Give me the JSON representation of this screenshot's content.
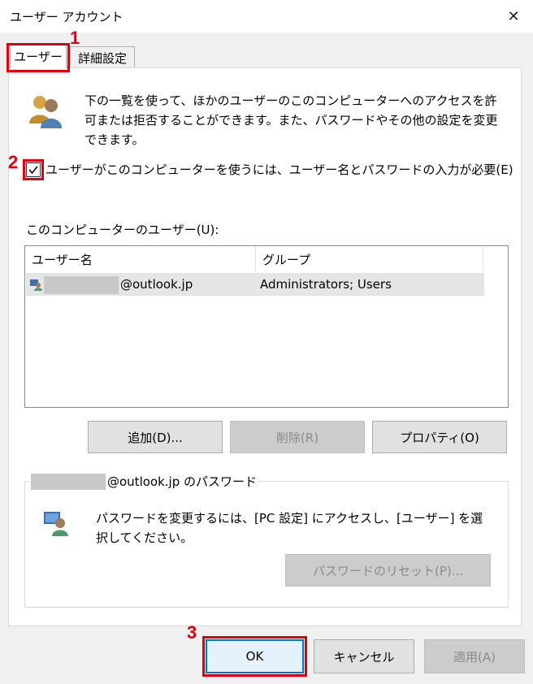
{
  "window": {
    "title": "ユーザー アカウント",
    "close_glyph": "✕"
  },
  "tabs": [
    {
      "label": "ユーザー",
      "active": true
    },
    {
      "label": "詳細設定",
      "active": false
    }
  ],
  "markers": [
    "1",
    "2",
    "3"
  ],
  "description": "下の一覧を使って、ほかのユーザーのこのコンピューターへのアクセスを許可または拒否することができます。また、パスワードやその他の設定を変更できます。",
  "require_login": {
    "label": "ユーザーがこのコンピューターを使うには、ユーザー名とパスワードの入力が必要(E)",
    "checked": true
  },
  "users_list": {
    "label": "このコンピューターのユーザー(U):",
    "columns": [
      "ユーザー名",
      "グループ"
    ],
    "rows": [
      {
        "user_suffix": "@outlook.jp",
        "group": "Administrators; Users"
      }
    ]
  },
  "list_buttons": {
    "add": "追加(D)...",
    "remove": "削除(R)",
    "properties": "プロパティ(O)"
  },
  "password_group": {
    "title_suffix": "@outlook.jp のパスワード",
    "text": "パスワードを変更するには、[PC 設定] にアクセスし、[ユーザー] を選択してください。",
    "reset_button": "パスワードのリセット(P)..."
  },
  "footer_buttons": {
    "ok": "OK",
    "cancel": "キャンセル",
    "apply": "適用(A)"
  },
  "colors": {
    "highlight": "#e2000f",
    "accent": "#0078d7"
  }
}
